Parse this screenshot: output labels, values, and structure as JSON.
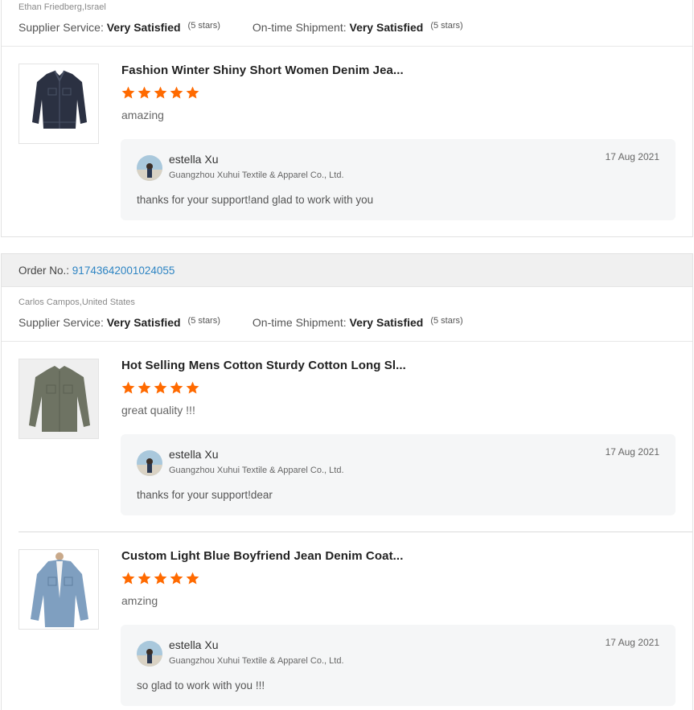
{
  "colors": {
    "star": "#ff6a00",
    "order_link": "#2d84c3",
    "reply_bg": "#f5f6f7"
  },
  "review_groups": [
    {
      "order_label": "",
      "order_number": "",
      "buyer": "Ethan Friedberg,Israel",
      "supplier_service_label": "Supplier Service:",
      "supplier_service_value": "Very Satisfied",
      "supplier_service_stars": "(5 stars)",
      "shipment_label": "On-time Shipment:",
      "shipment_value": "Very Satisfied",
      "shipment_stars": "(5 stars)",
      "products": [
        {
          "title": "Fashion Winter Shiny Short Women Denim Jea...",
          "rating": 5,
          "review": "amazing",
          "image_icon": "dark-denim-jacket-image",
          "reply": {
            "name": "estella Xu",
            "company": "Guangzhou Xuhui Textile & Apparel Co., Ltd.",
            "date": "17 Aug 2021",
            "text": "thanks for your support!and glad to work with you"
          }
        }
      ]
    },
    {
      "order_label": "Order No.:",
      "order_number": "91743642001024055",
      "buyer": "Carlos Campos,United States",
      "supplier_service_label": "Supplier Service:",
      "supplier_service_value": "Very Satisfied",
      "supplier_service_stars": "(5 stars)",
      "shipment_label": "On-time Shipment:",
      "shipment_value": "Very Satisfied",
      "shipment_stars": "(5 stars)",
      "products": [
        {
          "title": "Hot Selling Mens Cotton Sturdy Cotton Long Sl...",
          "rating": 5,
          "review": "great quality !!!",
          "image_icon": "green-shirt-image",
          "reply": {
            "name": "estella Xu",
            "company": "Guangzhou Xuhui Textile & Apparel Co., Ltd.",
            "date": "17 Aug 2021",
            "text": "thanks for your support!dear"
          }
        },
        {
          "title": "Custom Light Blue Boyfriend Jean Denim Coat...",
          "rating": 5,
          "review": "amzing",
          "image_icon": "light-denim-coat-image",
          "reply": {
            "name": "estella Xu",
            "company": "Guangzhou Xuhui Textile & Apparel Co., Ltd.",
            "date": "17 Aug 2021",
            "text": "so glad to work with you !!!"
          }
        }
      ]
    }
  ]
}
